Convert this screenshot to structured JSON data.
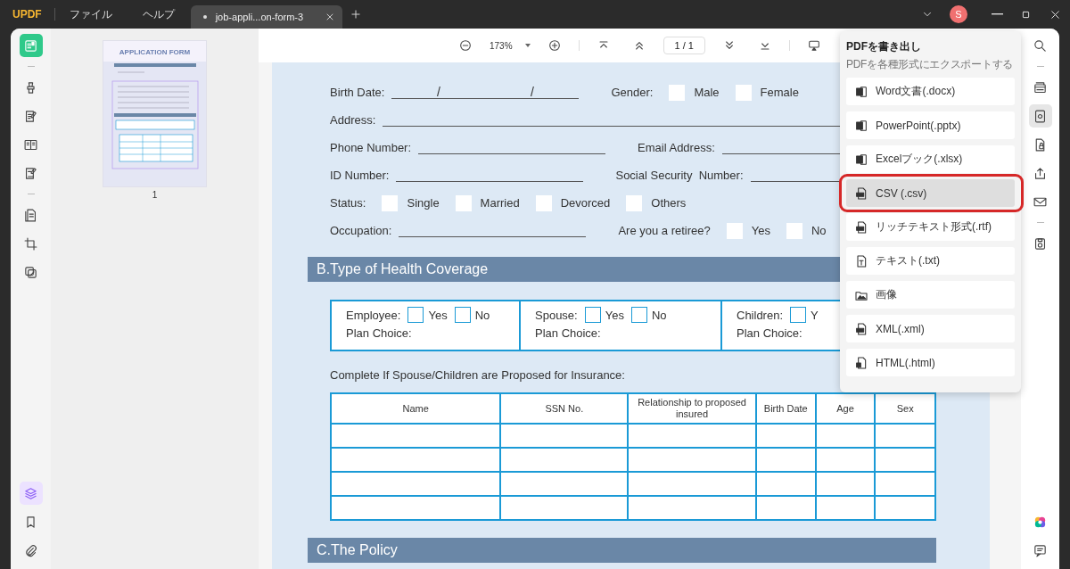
{
  "app": {
    "logo": "UPDF",
    "menu": [
      "ファイル",
      "ヘルプ"
    ],
    "avatar": "S"
  },
  "tabs": [
    {
      "label": "job-appli...on-form-3",
      "selected": true
    }
  ],
  "left_tools": [
    {
      "kind": "reader",
      "selected": true
    },
    {
      "kind": "divider"
    },
    {
      "kind": "highlight",
      "selected": false
    },
    {
      "kind": "edit",
      "selected": false
    },
    {
      "kind": "organize",
      "selected": false
    },
    {
      "kind": "form",
      "selected": false
    },
    {
      "kind": "divider"
    },
    {
      "kind": "pages",
      "selected": false
    },
    {
      "kind": "crop",
      "selected": false
    },
    {
      "kind": "watermark",
      "selected": false
    }
  ],
  "left_panels": [
    {
      "kind": "layers",
      "selected": true
    },
    {
      "kind": "bookmark",
      "selected": false
    },
    {
      "kind": "attach",
      "selected": false
    }
  ],
  "thumbnails": [
    {
      "title": "APPLICATION FORM",
      "page": "1"
    }
  ],
  "toolbar": {
    "zoom": "173%",
    "page": "1 / 1"
  },
  "form_rows": [
    {
      "parts": [
        {
          "kind": "text",
          "text": "Birth Date:"
        },
        {
          "kind": "date_line",
          "marks": [
            "/",
            "/"
          ]
        },
        {
          "kind": "text",
          "text": "Gender:"
        },
        {
          "kind": "checkbox",
          "checked": false
        },
        {
          "kind": "text",
          "text": "Male"
        },
        {
          "kind": "checkbox",
          "checked": false
        },
        {
          "kind": "text",
          "text": "Female"
        }
      ]
    },
    {
      "parts": [
        {
          "kind": "text",
          "text": "Address:"
        },
        {
          "kind": "long_line"
        }
      ]
    },
    {
      "parts": [
        {
          "kind": "text",
          "text": "Phone Number:"
        },
        {
          "kind": "line"
        },
        {
          "kind": "text",
          "text": "Email Address:"
        },
        {
          "kind": "long_line"
        }
      ]
    },
    {
      "parts": [
        {
          "kind": "text",
          "text": "ID Number:"
        },
        {
          "kind": "line"
        },
        {
          "kind": "text",
          "text": "Social Security  Number:"
        },
        {
          "kind": "long_line"
        }
      ]
    },
    {
      "parts": [
        {
          "kind": "text",
          "text": "Status:"
        },
        {
          "kind": "checkbox",
          "checked": false
        },
        {
          "kind": "text",
          "text": "Single"
        },
        {
          "kind": "checkbox",
          "checked": false
        },
        {
          "kind": "text",
          "text": "Married"
        },
        {
          "kind": "checkbox",
          "checked": false
        },
        {
          "kind": "text",
          "text": "Devorced"
        },
        {
          "kind": "checkbox",
          "checked": false
        },
        {
          "kind": "text",
          "text": "Others"
        }
      ]
    },
    {
      "parts": [
        {
          "kind": "text",
          "text": "Occupation:"
        },
        {
          "kind": "line"
        },
        {
          "kind": "text",
          "text": "Are you a retiree?"
        },
        {
          "kind": "checkbox",
          "checked": false
        },
        {
          "kind": "text",
          "text": "Yes"
        },
        {
          "kind": "checkbox",
          "checked": false
        },
        {
          "kind": "text",
          "text": "No"
        }
      ]
    }
  ],
  "section_b": "B.Type of Health Coverage",
  "coverage": [
    {
      "label": "Employee:",
      "options": [
        {
          "label": "Yes",
          "checked": false
        },
        {
          "label": "No",
          "checked": false
        }
      ],
      "plan": "Plan Choice:"
    },
    {
      "label": "Spouse:",
      "options": [
        {
          "label": "Yes",
          "checked": false
        },
        {
          "label": "No",
          "checked": false
        }
      ],
      "plan": "Plan Choice:"
    },
    {
      "label": "Children:",
      "options": [
        {
          "label": "Y",
          "checked": false
        }
      ],
      "plan": "Plan Choice:"
    }
  ],
  "insurance_note": "Complete If Spouse/Children are Proposed for Insurance:",
  "table": {
    "columns": [
      "Name",
      "SSN No.",
      "Relationship to proposed insured",
      "Birth Date",
      "Age",
      "Sex"
    ]
  },
  "section_c": "C.The Policy",
  "export_panel": {
    "title": "PDFを書き出し",
    "subtitle": "PDFを各種形式にエクスポートする",
    "items": [
      {
        "kind": "word",
        "label": "Word文書(.docx)",
        "selected": false
      },
      {
        "kind": "ppt",
        "label": "PowerPoint(.pptx)",
        "selected": false
      },
      {
        "kind": "excel",
        "label": "Excelブック(.xlsx)",
        "selected": false
      },
      {
        "kind": "csv",
        "label": "CSV (.csv)",
        "selected": true
      },
      {
        "kind": "rtf",
        "label": "リッチテキスト形式(.rtf)",
        "selected": false
      },
      {
        "kind": "txt",
        "label": "テキスト(.txt)",
        "selected": false
      },
      {
        "kind": "image",
        "label": "画像",
        "selected": false
      },
      {
        "kind": "xml",
        "label": "XML(.xml)",
        "selected": false
      },
      {
        "kind": "html",
        "label": "HTML(.html)",
        "selected": false
      }
    ]
  },
  "right_tools": [
    {
      "kind": "search",
      "selected": false
    },
    {
      "kind": "divider"
    },
    {
      "kind": "ocr",
      "selected": false
    },
    {
      "kind": "convert",
      "selected": true
    },
    {
      "kind": "protect",
      "selected": false
    },
    {
      "kind": "share",
      "selected": false
    },
    {
      "kind": "email",
      "selected": false
    },
    {
      "kind": "divider"
    },
    {
      "kind": "save",
      "selected": false
    }
  ],
  "right_bottom": [
    {
      "kind": "ai",
      "selected": false
    },
    {
      "kind": "comment",
      "selected": false
    }
  ]
}
